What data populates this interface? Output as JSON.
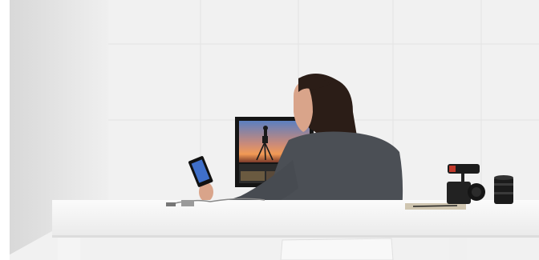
{
  "scene": {
    "description_visible_text": "",
    "colors": {
      "wall": "#f2f2f2",
      "wall_shadow": "#d9d9d9",
      "desk": "#f7f7f7",
      "sweater": "#4b4f55",
      "hair": "#2b1d17",
      "skin": "#d9a48a",
      "sunset_top": "#4a6fb3",
      "sunset_mid": "#f0955a",
      "sunset_low": "#7a3a2a",
      "camera": "#222222",
      "mic_accent": "#c0392b"
    },
    "icons": [
      "smartphone-icon",
      "camera-icon",
      "lens-icon",
      "monitor-icon"
    ]
  }
}
